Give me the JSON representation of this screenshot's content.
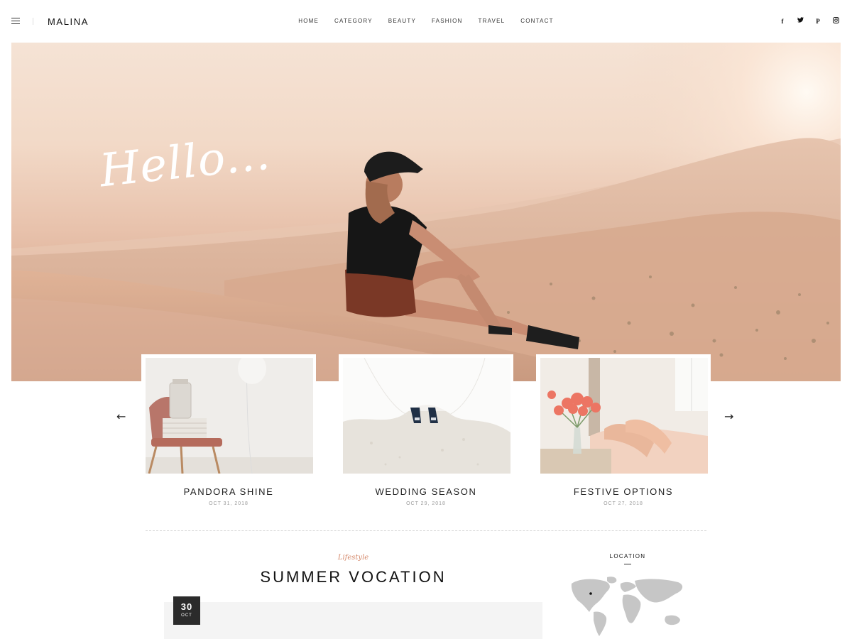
{
  "header": {
    "logo": "MALINA",
    "nav": [
      "HOME",
      "CATEGORY",
      "BEAUTY",
      "FASHION",
      "TRAVEL",
      "CONTACT"
    ],
    "social": [
      {
        "name": "facebook-icon",
        "glyph": "f"
      },
      {
        "name": "twitter-icon",
        "glyph": "🐦"
      },
      {
        "name": "pinterest-icon",
        "glyph": "P"
      },
      {
        "name": "instagram-icon",
        "glyph": "◎"
      }
    ]
  },
  "hero": {
    "script_text": "Hello..."
  },
  "slider": {
    "prev_icon": "←",
    "next_icon": "→",
    "cards": [
      {
        "title": "PANDORA SHINE",
        "date": "OCT 31, 2018"
      },
      {
        "title": "WEDDING SEASON",
        "date": "OCT 29, 2018"
      },
      {
        "title": "FESTIVE OPTIONS",
        "date": "OCT 27, 2018"
      }
    ]
  },
  "post": {
    "category": "Lifestyle",
    "title": "SUMMER VOCATION",
    "date_day": "30",
    "date_month": "OCT"
  },
  "sidebar": {
    "location_title": "LOCATION"
  },
  "colors": {
    "accent": "#d5896b",
    "badge_bg": "#2b2b2b",
    "text": "#222222"
  }
}
